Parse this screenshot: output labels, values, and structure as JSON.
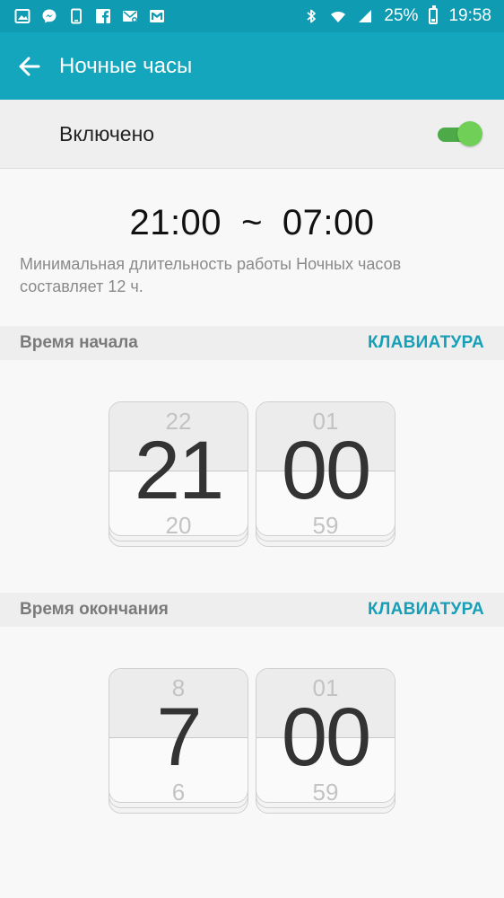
{
  "status_bar": {
    "battery": "25%",
    "time": "19:58",
    "icons_left": [
      "gallery-icon",
      "messenger-icon",
      "device-icon",
      "facebook-icon",
      "email-icon",
      "mail-icon"
    ],
    "icons_right": [
      "bluetooth-icon",
      "wifi-icon",
      "signal-icon",
      "battery-icon"
    ]
  },
  "app_bar": {
    "title": "Ночные часы"
  },
  "enabled": {
    "label": "Включено",
    "on": true
  },
  "summary": {
    "start": "21:00",
    "separator": "~",
    "end": "07:00",
    "note": "Минимальная длительность работы Ночных часов составляет 12 ч."
  },
  "start_time": {
    "title": "Время начала",
    "keyboard": "КЛАВИАТУРА",
    "hours": {
      "prev": "22",
      "current": "21",
      "next": "20"
    },
    "minutes": {
      "prev": "01",
      "current": "00",
      "next": "59"
    }
  },
  "end_time": {
    "title": "Время окончания",
    "keyboard": "КЛАВИАТУРА",
    "hours": {
      "prev": "8",
      "current": "7",
      "next": "6"
    },
    "minutes": {
      "prev": "01",
      "current": "00",
      "next": "59"
    }
  },
  "colors": {
    "status_bar": "#0f9bb1",
    "app_bar": "#13a6bd",
    "accent": "#16a0b8",
    "toggle_on": "#4caa48"
  }
}
